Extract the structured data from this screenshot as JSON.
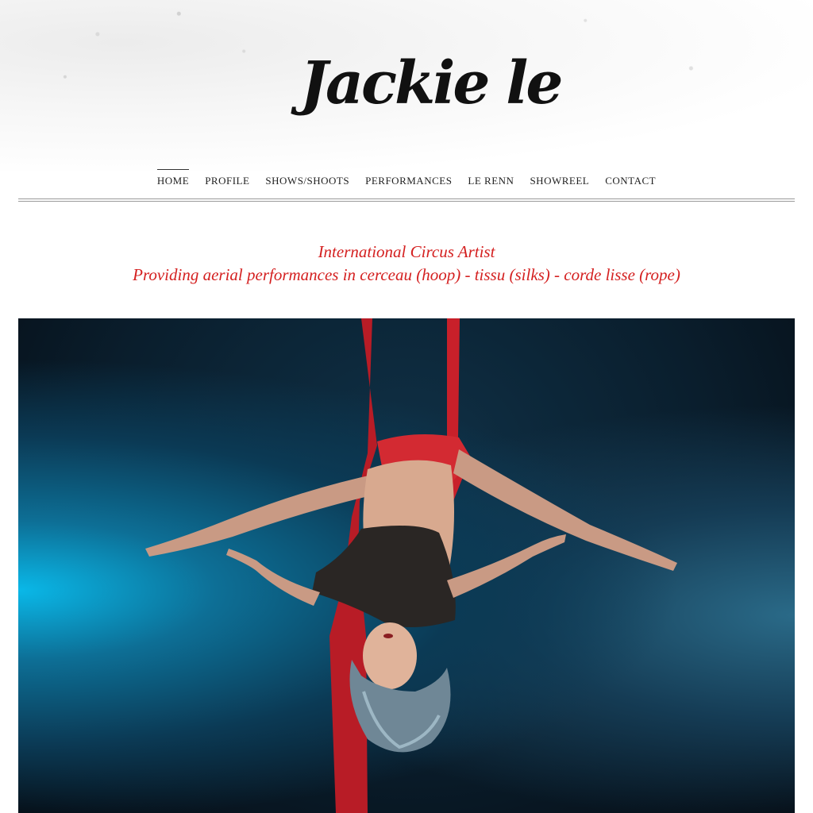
{
  "site": {
    "logo_text": "Jackie le"
  },
  "nav": {
    "items": [
      {
        "label": "HOME",
        "active": true
      },
      {
        "label": "PROFILE"
      },
      {
        "label": "SHOWS/SHOOTS"
      },
      {
        "label": "PERFORMANCES"
      },
      {
        "label": "LE RENN"
      },
      {
        "label": "SHOWREEL"
      },
      {
        "label": "CONTACT"
      }
    ]
  },
  "main": {
    "tagline_line1": "International Circus Artist",
    "tagline_line2": "Providing aerial performances in cerceau (hoop) - tissu (silks) - corde lisse (rope)"
  },
  "colors": {
    "accent": "#d42020",
    "silk": "#c8202a"
  }
}
